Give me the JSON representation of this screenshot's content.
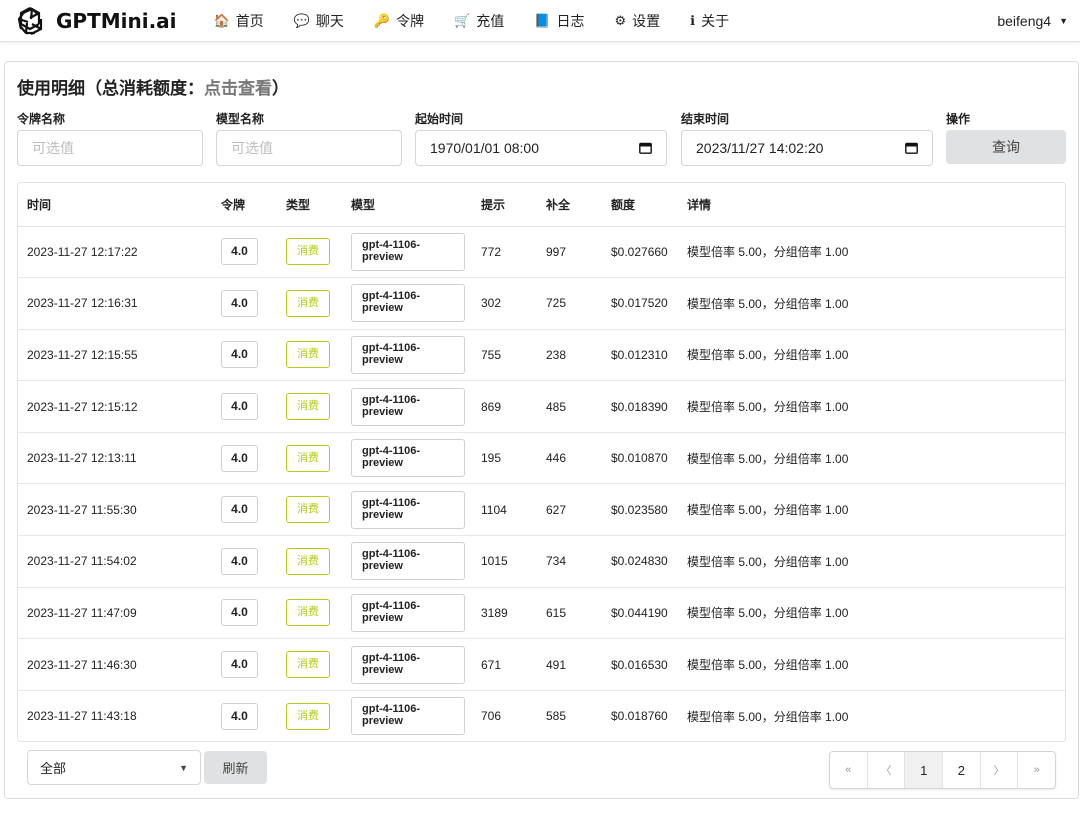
{
  "brand": {
    "name": "GPTMini.ai",
    "logo": "openai-logo"
  },
  "nav": [
    {
      "icon": "home-icon",
      "glyph": "🏠",
      "label": "首页"
    },
    {
      "icon": "chat-icon",
      "glyph": "💬",
      "label": "聊天"
    },
    {
      "icon": "key-icon",
      "glyph": "🔑",
      "label": "令牌"
    },
    {
      "icon": "cart-icon",
      "glyph": "🛒",
      "label": "充值"
    },
    {
      "icon": "book-icon",
      "glyph": "📘",
      "label": "日志"
    },
    {
      "icon": "gear-icon",
      "glyph": "⚙",
      "label": "设置"
    },
    {
      "icon": "info-icon",
      "glyph": "ℹ",
      "label": "关于"
    }
  ],
  "user": {
    "name": "beifeng4"
  },
  "card": {
    "title": "使用明细（总消耗额度：",
    "title_link": "点击查看",
    "title_end": "）"
  },
  "filters": {
    "token_label": "令牌名称",
    "token_placeholder": "可选值",
    "model_label": "模型名称",
    "model_placeholder": "可选值",
    "start_label": "起始时间",
    "start_value": "1970/01/01 08:00",
    "end_label": "结束时间",
    "end_value": "2023/11/27 14:02:20",
    "action_label": "操作",
    "query_button": "查询"
  },
  "table": {
    "headers": [
      "时间",
      "令牌",
      "类型",
      "模型",
      "提示",
      "补全",
      "额度",
      "详情"
    ],
    "rows": [
      {
        "time": "2023-11-27 12:17:22",
        "token": "4.0",
        "type": "消费",
        "model1": "gpt-4-1106-",
        "model2": "preview",
        "prompt": "772",
        "completion": "997",
        "quota": "$0.027660",
        "detail": "模型倍率 5.00，分组倍率 1.00"
      },
      {
        "time": "2023-11-27 12:16:31",
        "token": "4.0",
        "type": "消费",
        "model1": "gpt-4-1106-",
        "model2": "preview",
        "prompt": "302",
        "completion": "725",
        "quota": "$0.017520",
        "detail": "模型倍率 5.00，分组倍率 1.00"
      },
      {
        "time": "2023-11-27 12:15:55",
        "token": "4.0",
        "type": "消费",
        "model1": "gpt-4-1106-",
        "model2": "preview",
        "prompt": "755",
        "completion": "238",
        "quota": "$0.012310",
        "detail": "模型倍率 5.00，分组倍率 1.00"
      },
      {
        "time": "2023-11-27 12:15:12",
        "token": "4.0",
        "type": "消费",
        "model1": "gpt-4-1106-",
        "model2": "preview",
        "prompt": "869",
        "completion": "485",
        "quota": "$0.018390",
        "detail": "模型倍率 5.00，分组倍率 1.00"
      },
      {
        "time": "2023-11-27 12:13:11",
        "token": "4.0",
        "type": "消费",
        "model1": "gpt-4-1106-",
        "model2": "preview",
        "prompt": "195",
        "completion": "446",
        "quota": "$0.010870",
        "detail": "模型倍率 5.00，分组倍率 1.00"
      },
      {
        "time": "2023-11-27 11:55:30",
        "token": "4.0",
        "type": "消费",
        "model1": "gpt-4-1106-",
        "model2": "preview",
        "prompt": "1104",
        "completion": "627",
        "quota": "$0.023580",
        "detail": "模型倍率 5.00，分组倍率 1.00"
      },
      {
        "time": "2023-11-27 11:54:02",
        "token": "4.0",
        "type": "消费",
        "model1": "gpt-4-1106-",
        "model2": "preview",
        "prompt": "1015",
        "completion": "734",
        "quota": "$0.024830",
        "detail": "模型倍率 5.00，分组倍率 1.00"
      },
      {
        "time": "2023-11-27 11:47:09",
        "token": "4.0",
        "type": "消费",
        "model1": "gpt-4-1106-",
        "model2": "preview",
        "prompt": "3189",
        "completion": "615",
        "quota": "$0.044190",
        "detail": "模型倍率 5.00，分组倍率 1.00"
      },
      {
        "time": "2023-11-27 11:46:30",
        "token": "4.0",
        "type": "消费",
        "model1": "gpt-4-1106-",
        "model2": "preview",
        "prompt": "671",
        "completion": "491",
        "quota": "$0.016530",
        "detail": "模型倍率 5.00，分组倍率 1.00"
      },
      {
        "time": "2023-11-27 11:43:18",
        "token": "4.0",
        "type": "消费",
        "model1": "gpt-4-1106-",
        "model2": "preview",
        "prompt": "706",
        "completion": "585",
        "quota": "$0.018760",
        "detail": "模型倍率 5.00，分组倍率 1.00"
      }
    ]
  },
  "footer": {
    "select_value": "全部",
    "refresh_button": "刷新",
    "pagination": [
      "«",
      "〈",
      "1",
      "2",
      "〉",
      "»"
    ],
    "current_page": "1"
  },
  "colors": {
    "accent_olive": "#b5cc18",
    "button_gray": "#e0e1e2"
  }
}
